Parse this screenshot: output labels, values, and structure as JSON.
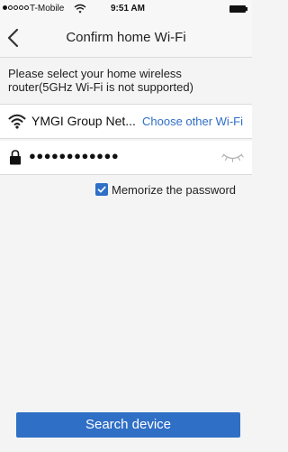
{
  "status_bar": {
    "carrier": "T-Mobile",
    "time": "9:51 AM",
    "signal_bars": 1,
    "signal_total": 5
  },
  "nav": {
    "title": "Confirm home Wi-Fi"
  },
  "instruction": "Please select your home wireless router(5GHz Wi-Fi is not supported)",
  "wifi": {
    "network_name": "YMGI Group Net...",
    "choose_other": "Choose other Wi-Fi"
  },
  "password": {
    "masked_value": "●●●●●●●●●●●●"
  },
  "memorize": {
    "label": "Memorize the password",
    "checked": true
  },
  "actions": {
    "search_label": "Search device"
  },
  "colors": {
    "accent": "#2f6fc6",
    "background": "#f4f4f4",
    "row_background": "#ffffff"
  }
}
